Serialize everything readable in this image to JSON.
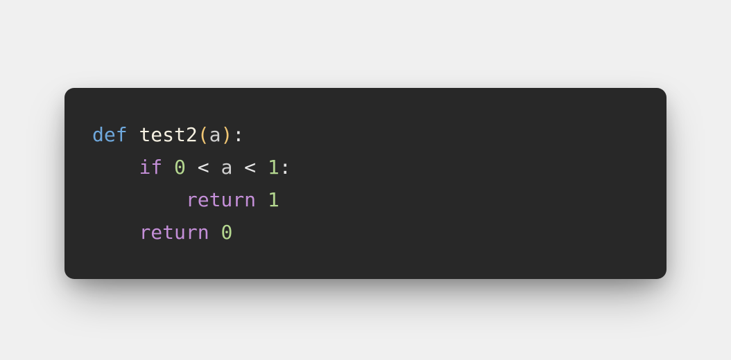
{
  "code": {
    "language": "python",
    "tokens": {
      "def": "def",
      "func_name": "test2",
      "paren_open": "(",
      "param_a": "a",
      "paren_close": ")",
      "colon1": ":",
      "if_kw": "if",
      "num0": "0",
      "lt1": "<",
      "var_a": "a",
      "lt2": "<",
      "num1": "1",
      "colon2": ":",
      "return1": "return",
      "ret_val1": "1",
      "return2": "return",
      "ret_val2": "0"
    }
  }
}
